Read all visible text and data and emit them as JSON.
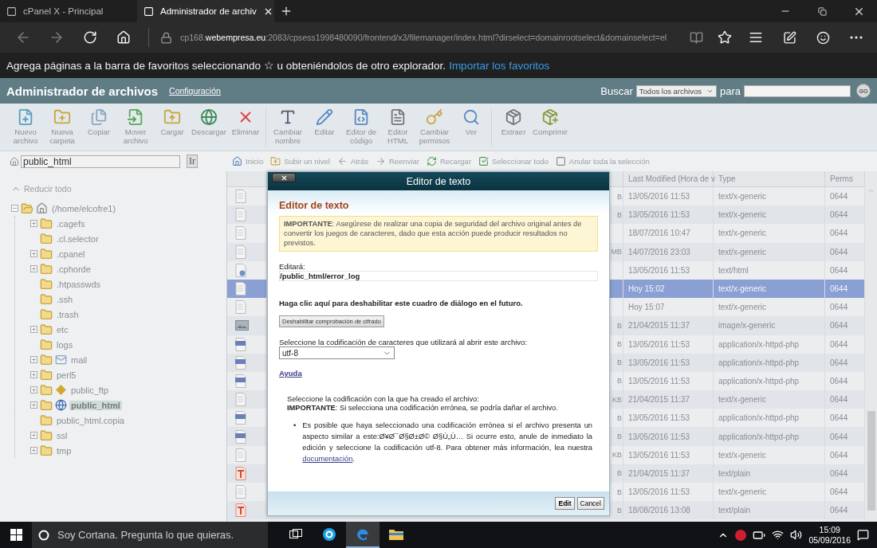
{
  "browser": {
    "tabs": [
      {
        "title": "cPanel X - Principal",
        "selected": false
      },
      {
        "title": "Administrador de archiv",
        "selected": true
      }
    ],
    "url": "cp168.**webempresa.eu**:2083/cpsess1998480090/frontend/x3/filemanager/index.html?dirselect=domainrootselect&domainselect=el",
    "favorites_bar": {
      "text": "Agrega páginas a la barra de favoritos seleccionando ☆ u obteniéndolos de otro explorador.",
      "link": "Importar los favoritos"
    }
  },
  "header": {
    "title": "Administrador de archivos",
    "settings_link": "Configuración",
    "search_label": "Buscar",
    "search_scope": "Todos los archivos",
    "for_label": "para",
    "go": "GO"
  },
  "toolbar": {
    "groups": [
      [
        {
          "kind": "new-file",
          "label": "Nuevo archivo"
        },
        {
          "kind": "new-folder",
          "label": "Nueva carpeta"
        },
        {
          "kind": "copy",
          "label": "Copiar"
        },
        {
          "kind": "move",
          "label": "Mover archivo"
        },
        {
          "kind": "upload",
          "label": "Cargar"
        },
        {
          "kind": "download",
          "label": "Descargar"
        },
        {
          "kind": "delete",
          "label": "Eliminar"
        }
      ],
      [
        {
          "kind": "rename",
          "label": "Cambiar nombre"
        },
        {
          "kind": "edit",
          "label": "Editar"
        },
        {
          "kind": "code-editor",
          "label": "Editor de código"
        },
        {
          "kind": "html-editor",
          "label": "Editor HTML"
        },
        {
          "kind": "permissions",
          "label": "Cambiar permisos"
        },
        {
          "kind": "view",
          "label": "Ver"
        }
      ],
      [
        {
          "kind": "extract",
          "label": "Extraer"
        },
        {
          "kind": "compress",
          "label": "Comprimir"
        }
      ]
    ]
  },
  "path_bar": {
    "value": "public_html",
    "go": "Ir"
  },
  "nav": [
    {
      "kind": "home",
      "label": "Inicio"
    },
    {
      "kind": "up",
      "label": "Subir un nivel"
    },
    {
      "kind": "back",
      "label": "Atrás"
    },
    {
      "kind": "forward",
      "label": "Reenviar"
    },
    {
      "kind": "reload",
      "label": "Recargar"
    },
    {
      "kind": "select-all",
      "label": "Seleccionar todo"
    },
    {
      "kind": "unselect",
      "label": "Anular toda la selección"
    }
  ],
  "tree": {
    "collapse_all": "Reducir todo",
    "items": [
      {
        "label": "(/home/elcofre1)",
        "kind": "home",
        "has_children": true,
        "expanded": true,
        "selected": false,
        "children": [
          {
            "label": ".cagefs",
            "kind": "folder",
            "has_children": true,
            "expanded": false,
            "selected": false
          },
          {
            "label": ".cl.selector",
            "kind": "folder",
            "has_children": false,
            "expanded": false,
            "selected": false
          },
          {
            "label": ".cpanel",
            "kind": "folder",
            "has_children": true,
            "expanded": false,
            "selected": false
          },
          {
            "label": ".cphorde",
            "kind": "folder",
            "has_children": true,
            "expanded": false,
            "selected": false
          },
          {
            "label": ".htpasswds",
            "kind": "folder",
            "has_children": false,
            "expanded": false,
            "selected": false
          },
          {
            "label": ".ssh",
            "kind": "folder",
            "has_children": false,
            "expanded": false,
            "selected": false
          },
          {
            "label": ".trash",
            "kind": "folder",
            "has_children": false,
            "expanded": false,
            "selected": false
          },
          {
            "label": "etc",
            "kind": "folder",
            "has_children": true,
            "expanded": false,
            "selected": false
          },
          {
            "label": "logs",
            "kind": "folder",
            "has_children": false,
            "expanded": false,
            "selected": false
          },
          {
            "label": "mail",
            "kind": "mail",
            "has_children": true,
            "expanded": false,
            "selected": false
          },
          {
            "label": "perl5",
            "kind": "folder",
            "has_children": true,
            "expanded": false,
            "selected": false
          },
          {
            "label": "public_ftp",
            "kind": "ftp",
            "has_children": true,
            "expanded": false,
            "selected": false
          },
          {
            "label": "public_html",
            "kind": "web",
            "has_children": true,
            "expanded": false,
            "selected": true
          },
          {
            "label": "public_html.copia",
            "kind": "folder",
            "has_children": false,
            "expanded": false,
            "selected": false
          },
          {
            "label": "ssl",
            "kind": "folder",
            "has_children": true,
            "expanded": false,
            "selected": false
          },
          {
            "label": "tmp",
            "kind": "folder",
            "has_children": true,
            "expanded": false,
            "selected": false
          }
        ]
      }
    ]
  },
  "table": {
    "columns": [
      "Last Modified (Hora de v",
      "Type",
      "Perms"
    ],
    "rows": [
      {
        "kind": "generic",
        "column_3": "B",
        "modified": "13/05/2016 11:53",
        "type": "text/x-generic",
        "perms": "0644",
        "selected": false
      },
      {
        "kind": "generic",
        "column_3": "B",
        "modified": "13/05/2016 11:53",
        "type": "text/x-generic",
        "perms": "0644",
        "selected": false
      },
      {
        "kind": "generic",
        "modified": "18/07/2016 10:47",
        "type": "text/x-generic",
        "perms": "0644",
        "selected": false
      },
      {
        "kind": "generic",
        "column_3": "MB",
        "modified": "14/07/2016 23:03",
        "type": "text/x-generic",
        "perms": "0644",
        "selected": false
      },
      {
        "kind": "html",
        "modified": "13/05/2016 11:53",
        "type": "text/html",
        "perms": "0644",
        "selected": false
      },
      {
        "kind": "generic",
        "modified": "Hoy 15:02",
        "type": "text/x-generic",
        "perms": "0644",
        "selected": true
      },
      {
        "kind": "generic",
        "modified": "Hoy 15:07",
        "type": "text/x-generic",
        "perms": "0644",
        "selected": false
      },
      {
        "kind": "image",
        "column_3": "B",
        "modified": "21/04/2015 11:37",
        "type": "image/x-generic",
        "perms": "0644",
        "selected": false
      },
      {
        "kind": "php",
        "column_3": "B",
        "modified": "13/05/2016 11:53",
        "type": "application/x-httpd-php",
        "perms": "0644",
        "selected": false
      },
      {
        "kind": "php",
        "column_3": "B",
        "modified": "13/05/2016 11:53",
        "type": "application/x-httpd-php",
        "perms": "0644",
        "selected": false
      },
      {
        "kind": "php",
        "column_3": "B",
        "modified": "13/05/2016 11:53",
        "type": "application/x-httpd-php",
        "perms": "0644",
        "selected": false
      },
      {
        "kind": "generic",
        "column_3": "KB",
        "modified": "21/04/2015 11:37",
        "type": "text/x-generic",
        "perms": "0644",
        "selected": false
      },
      {
        "kind": "php",
        "column_3": "B",
        "modified": "13/05/2016 11:53",
        "type": "application/x-httpd-php",
        "perms": "0644",
        "selected": false
      },
      {
        "kind": "php",
        "column_3": "B",
        "modified": "13/05/2016 11:53",
        "type": "application/x-httpd-php",
        "perms": "0644",
        "selected": false
      },
      {
        "kind": "generic",
        "column_3": "KB",
        "modified": "13/05/2016 11:53",
        "type": "text/x-generic",
        "perms": "0644",
        "selected": false
      },
      {
        "kind": "plain",
        "column_3": "B",
        "modified": "21/04/2015 11:37",
        "type": "text/plain",
        "perms": "0644",
        "selected": false
      },
      {
        "kind": "generic",
        "column_3": "B",
        "modified": "13/05/2016 11:53",
        "type": "text/x-generic",
        "perms": "0644",
        "selected": false
      },
      {
        "kind": "plain",
        "column_3": "B",
        "modified": "18/08/2016 13:08",
        "type": "text/plain",
        "perms": "0644",
        "selected": false
      }
    ]
  },
  "dialog": {
    "title": "Editor de texto",
    "heading": "Editor de texto",
    "warning": "**IMPORTANTE**: Asegúrese de realizar una copia de seguridad del archivo original antes de convertir los juegos de caracteres, dado que esta acción puede producir resultados no previstos.",
    "edit_label": "Editará:",
    "edit_path": "/public_html/error_log",
    "disable_hint": "Haga clic aquí para deshabilitar este cuadro de diálogo en el futuro.",
    "disable_button": "Deshabilitar comprobación de cifrado",
    "encoding_label": "Seleccione la codificación de caracteres que utilizará al abrir este archivo:",
    "encoding": "utf-8",
    "help_link": "Ayuda",
    "note_title": "Seleccione la codificación con la que ha creado el archivo:",
    "note_warning": "**IMPORTANTE**: Si selecciona una codificación errónea, se podría dañar el archivo.",
    "bullet": "Es posible que haya seleccionado una codificación errónea si el archivo presenta un aspecto similar a este:Ø¥Ø¯Ø§Ø±Ø© Ø§Ù„Ù… Si ocurre esto, anule de inmediato la edición y seleccione la codificación utf-8. Para obtener más información, lea nuestra",
    "bullet_mark": "•",
    "bullet_link": "documentación",
    "bullet_end": ".",
    "buttons": [
      "Edit",
      "Cancel"
    ]
  },
  "taskbar": {
    "search": "Soy Cortana. Pregunta lo que quieras.",
    "apps": [
      {
        "kind": "task-view",
        "selected": false
      },
      {
        "kind": "skype",
        "selected": false
      },
      {
        "kind": "edge",
        "selected": true
      },
      {
        "kind": "explorer",
        "selected": false
      }
    ],
    "time": "15:09",
    "date": "05/09/2016"
  }
}
